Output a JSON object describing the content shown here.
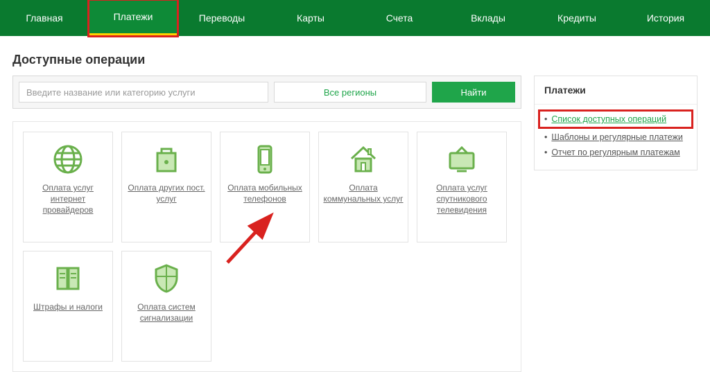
{
  "nav": {
    "items": [
      {
        "label": "Главная"
      },
      {
        "label": "Платежи",
        "active": true
      },
      {
        "label": "Переводы"
      },
      {
        "label": "Карты"
      },
      {
        "label": "Счета"
      },
      {
        "label": "Вклады"
      },
      {
        "label": "Кредиты"
      },
      {
        "label": "История"
      }
    ]
  },
  "page": {
    "title": "Доступные операции"
  },
  "search": {
    "placeholder": "Введите название или категорию услуги",
    "region_label": "Все регионы",
    "find_label": "Найти"
  },
  "tiles": [
    {
      "label": "Оплата услуг интернет провайдеров",
      "icon": "globe"
    },
    {
      "label": "Оплата других пост. услуг",
      "icon": "bag"
    },
    {
      "label": "Оплата мобильных телефонов",
      "icon": "phone"
    },
    {
      "label": "Оплата коммунальных услуг",
      "icon": "house"
    },
    {
      "label": "Оплата услуг спутникового телевидения",
      "icon": "tv"
    },
    {
      "label": "Штрафы и налоги",
      "icon": "receipt"
    },
    {
      "label": "Оплата систем сигнализации",
      "icon": "shield"
    }
  ],
  "sidebar": {
    "title": "Платежи",
    "items": [
      {
        "label": "Список доступных операций",
        "highlight": true
      },
      {
        "label": "Шаблоны и регулярные платежи"
      },
      {
        "label": "Отчет по регулярным платежам"
      }
    ]
  }
}
